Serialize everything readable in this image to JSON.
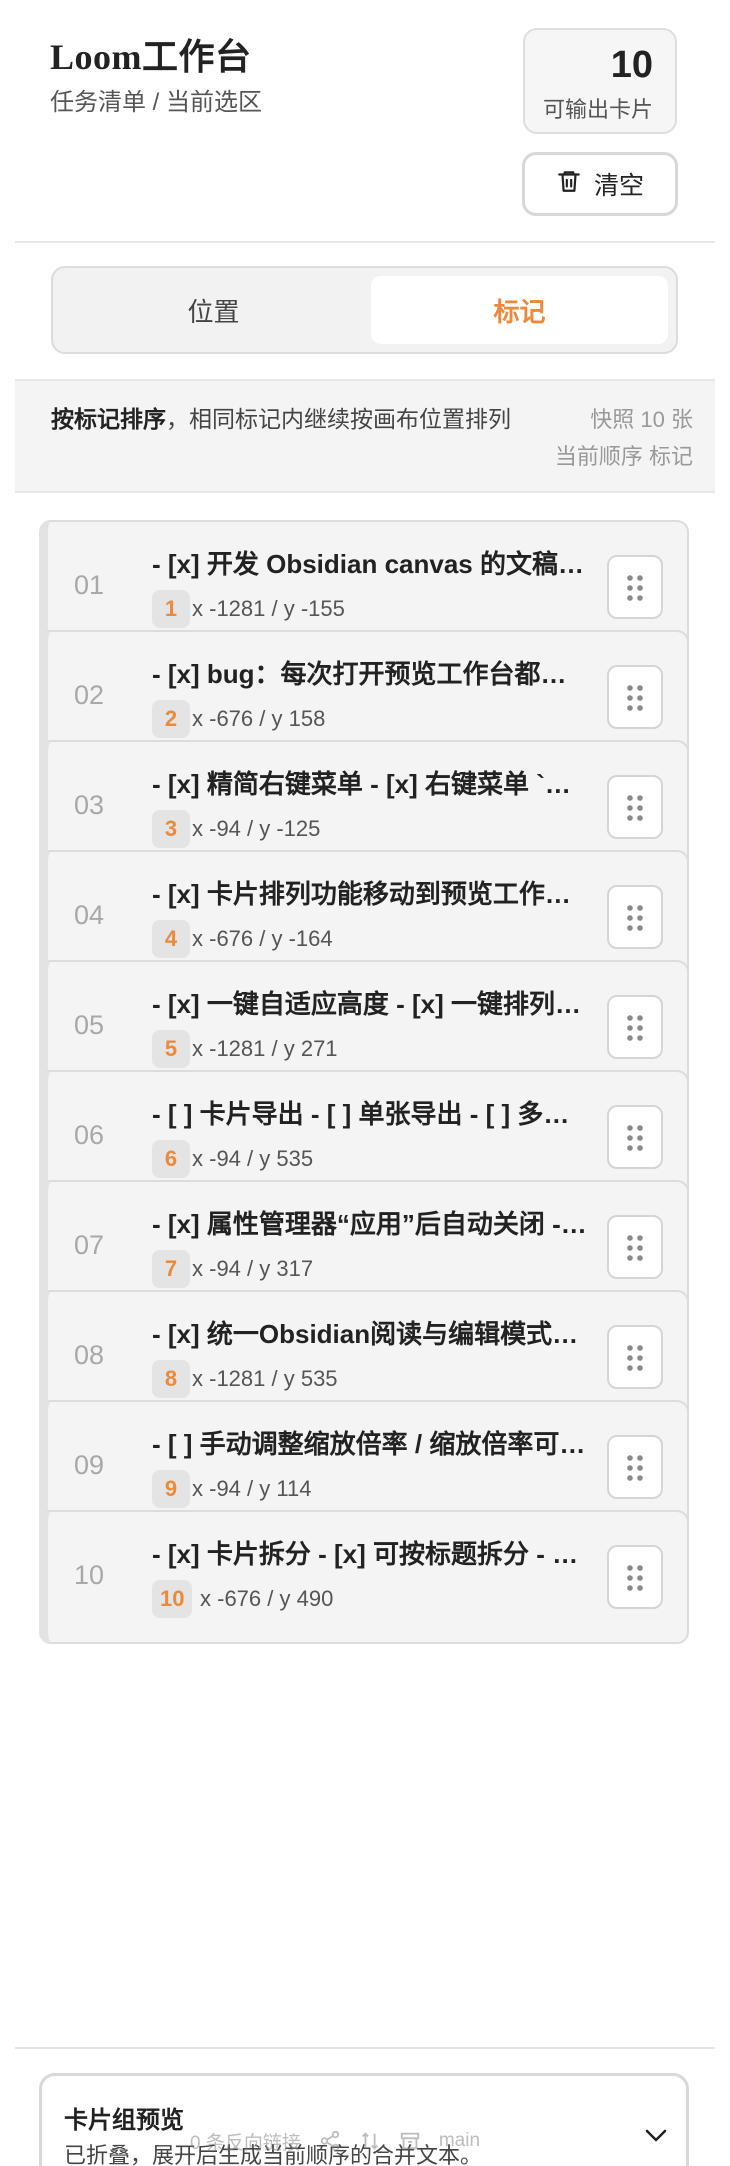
{
  "header": {
    "title": "Loom工作台",
    "subtitle": "任务清单 / 当前选区",
    "count": "10",
    "count_label": "可输出卡片",
    "clear_label": "清空"
  },
  "tabs": [
    {
      "label": "位置",
      "active": false
    },
    {
      "label": "标记",
      "active": true
    }
  ],
  "sort_info": {
    "strong": "按标记排序",
    "rest": "，相同标记内继续按画布位置排列",
    "meta_line1": "快照 10 张",
    "meta_line2": "当前顺序 标记"
  },
  "cards": [
    {
      "index": "01",
      "title": "- [x] 开发 Obsidian canvas 的文稿…",
      "badge": "1",
      "coord": "x -1281 / y -155"
    },
    {
      "index": "02",
      "title": "- [x] bug：每次打开预览工作台都…",
      "badge": "2",
      "coord": "x -676 / y 158"
    },
    {
      "index": "03",
      "title": "- [x] 精简右键菜单 - [x] 右键菜单 `…",
      "badge": "3",
      "coord": "x -94 / y -125"
    },
    {
      "index": "04",
      "title": "- [x] 卡片排列功能移动到预览工作…",
      "badge": "4",
      "coord": "x -676 / y -164"
    },
    {
      "index": "05",
      "title": "- [x] 一键自适应高度 - [x] 一键排列…",
      "badge": "5",
      "coord": "x -1281 / y 271"
    },
    {
      "index": "06",
      "title": "- [ ] 卡片导出 - [ ] 单张导出 - [ ] 多…",
      "badge": "6",
      "coord": "x -94 / y 535"
    },
    {
      "index": "07",
      "title": "- [x] 属性管理器“应用”后自动关闭 -…",
      "badge": "7",
      "coord": "x -94 / y 317"
    },
    {
      "index": "08",
      "title": "- [x] 统一Obsidian阅读与编辑模式…",
      "badge": "8",
      "coord": "x -1281 / y 535"
    },
    {
      "index": "09",
      "title": "- [ ] 手动调整缩放倍率 / 缩放倍率可…",
      "badge": "9",
      "coord": "x -94 / y 114"
    },
    {
      "index": "10",
      "title": "- [x] 卡片拆分 - [x] 可按标题拆分 - …",
      "badge": "10",
      "coord": "x -676 / y 490"
    }
  ],
  "preview": {
    "title": "卡片组预览",
    "subtitle": "已折叠，展开后生成当前顺序的合并文本。"
  },
  "statusbar": {
    "backlinks": "0 条反向链接",
    "branch": "main"
  },
  "colors": {
    "accent": "#ec8a3c",
    "card_bg": "#f4f4f4",
    "border": "#dcdcdc"
  }
}
